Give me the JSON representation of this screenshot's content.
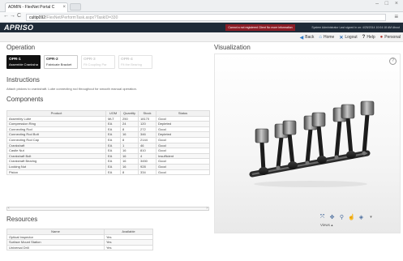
{
  "browser": {
    "tab_title": "ADMIN - FlexNet Portal C",
    "url_host": "cultip092",
    "url_path": "/FlexNet/PerformTask.aspx?TaskID=330"
  },
  "app": {
    "logo": "APRISO",
    "notice": "Cannot a not registered Client   No more information",
    "user_info": "System Administrator   Last signed in on: 4/25/2014 10:04:18 AM   About",
    "links": [
      {
        "label": "Back",
        "icon": "back-icon"
      },
      {
        "label": "Home",
        "icon": "home-icon"
      },
      {
        "label": "Logout",
        "icon": "logout-icon"
      },
      {
        "label": "Help",
        "icon": "help-icon"
      },
      {
        "label": "Personal",
        "icon": "person-icon"
      }
    ]
  },
  "operation": {
    "heading": "Operation",
    "items": [
      {
        "code": "OPR-1",
        "desc": "Assemble Crankshaft",
        "state": "active"
      },
      {
        "code": "OPR-2",
        "desc": "Fabricate Bracket",
        "state": "normal"
      },
      {
        "code": "OPR-3",
        "desc": "Fit Coupling Par",
        "state": "dim"
      },
      {
        "code": "OPR-4",
        "desc": "Fit the Bearing",
        "state": "dim"
      }
    ]
  },
  "instructions": {
    "heading": "Instructions",
    "text": "Attach pistons to crankshaft. Lube connecting rod throughout for smooth manual operation."
  },
  "components": {
    "heading": "Components",
    "columns": [
      "Product",
      "UOM",
      "Quantity",
      "Stock",
      "Status"
    ],
    "rows": [
      [
        "Assembly Lube",
        "MLT",
        "250",
        "18170",
        "Good"
      ],
      [
        "Compression Ring",
        "EA",
        "24",
        "120",
        "Depleted"
      ],
      [
        "Connecting Rod",
        "EA",
        "8",
        "272",
        "Good"
      ],
      [
        "Connecting Rod Bolt",
        "EA",
        "16",
        "346",
        "Depleted"
      ],
      [
        "Connecting Rod Cap",
        "EA",
        "8",
        "2144",
        "Good"
      ],
      [
        "Crankshaft",
        "EA",
        "1",
        "46",
        "Good"
      ],
      [
        "Castle Nut",
        "EA",
        "16",
        "810",
        "Good"
      ],
      [
        "Crankshaft Bolt",
        "EA",
        "16",
        "4",
        "Insufficient"
      ],
      [
        "Crankshaft Bearing",
        "EA",
        "16",
        "3450",
        "Good"
      ],
      [
        "Locking Nut",
        "EA",
        "16",
        "928",
        "Good"
      ],
      [
        "Piston",
        "EA",
        "8",
        "334",
        "Good"
      ]
    ]
  },
  "resources": {
    "heading": "Resources",
    "columns": [
      "Name",
      "Available"
    ],
    "rows": [
      [
        "Optical Inspector",
        "Yes"
      ],
      [
        "Surface Mount Station",
        "Yes"
      ],
      [
        "Universal Drill",
        "Yes"
      ]
    ]
  },
  "visualization": {
    "heading": "Visualization",
    "info_glyph": "?",
    "views_label": "Views",
    "tools": [
      "rotate-icon",
      "pan-icon",
      "zoom-icon",
      "select-icon",
      "cube-icon"
    ]
  }
}
